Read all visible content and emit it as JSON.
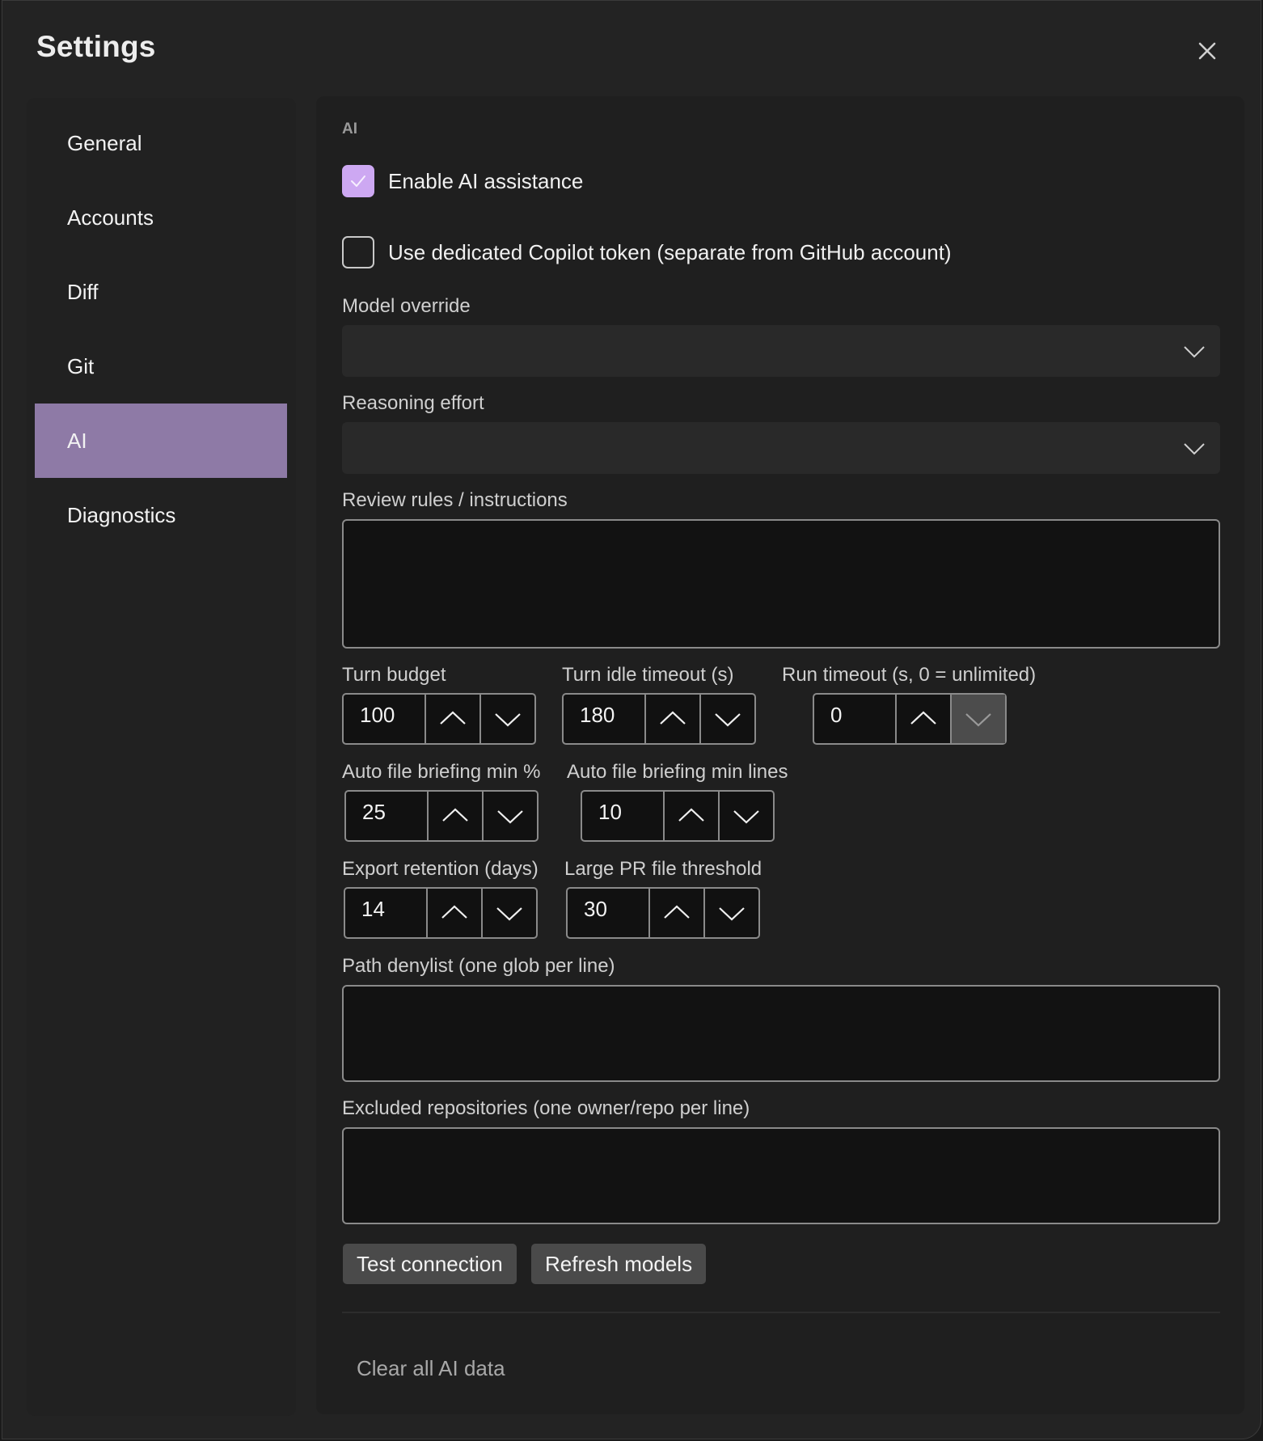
{
  "dialog": {
    "title": "Settings"
  },
  "sidebar": {
    "items": [
      {
        "label": "General"
      },
      {
        "label": "Accounts"
      },
      {
        "label": "Diff"
      },
      {
        "label": "Git"
      },
      {
        "label": "AI",
        "active": true
      },
      {
        "label": "Diagnostics"
      }
    ]
  },
  "ai": {
    "section_label": "AI",
    "enable_ai": {
      "label": "Enable AI assistance",
      "checked": true
    },
    "dedicated_token": {
      "label": "Use dedicated Copilot token (separate from GitHub account)",
      "checked": false
    },
    "model_override": {
      "label": "Model override",
      "value": ""
    },
    "reasoning_effort": {
      "label": "Reasoning effort",
      "value": ""
    },
    "review_rules": {
      "label": "Review rules / instructions",
      "value": ""
    },
    "turn_budget": {
      "label": "Turn budget",
      "value": "100"
    },
    "turn_idle_timeout": {
      "label": "Turn idle timeout (s)",
      "value": "180"
    },
    "run_timeout": {
      "label": "Run timeout (s, 0 = unlimited)",
      "value": "0"
    },
    "auto_briefing_min_pct": {
      "label": "Auto file briefing min %",
      "value": "25"
    },
    "auto_briefing_min_lines": {
      "label": "Auto file briefing min lines",
      "value": "10"
    },
    "export_retention": {
      "label": "Export retention (days)",
      "value": "14"
    },
    "large_pr_threshold": {
      "label": "Large PR file threshold",
      "value": "30"
    },
    "path_denylist": {
      "label": "Path denylist (one glob per line)",
      "value": ""
    },
    "excluded_repos": {
      "label": "Excluded repositories (one owner/repo per line)",
      "value": ""
    },
    "test_connection_label": "Test connection",
    "refresh_models_label": "Refresh models",
    "clear_all_label": "Clear all AI data"
  },
  "colors": {
    "accent_checkbox": "#cda8f2",
    "sidebar_active": "#8e7aa6",
    "background": "#232323"
  }
}
